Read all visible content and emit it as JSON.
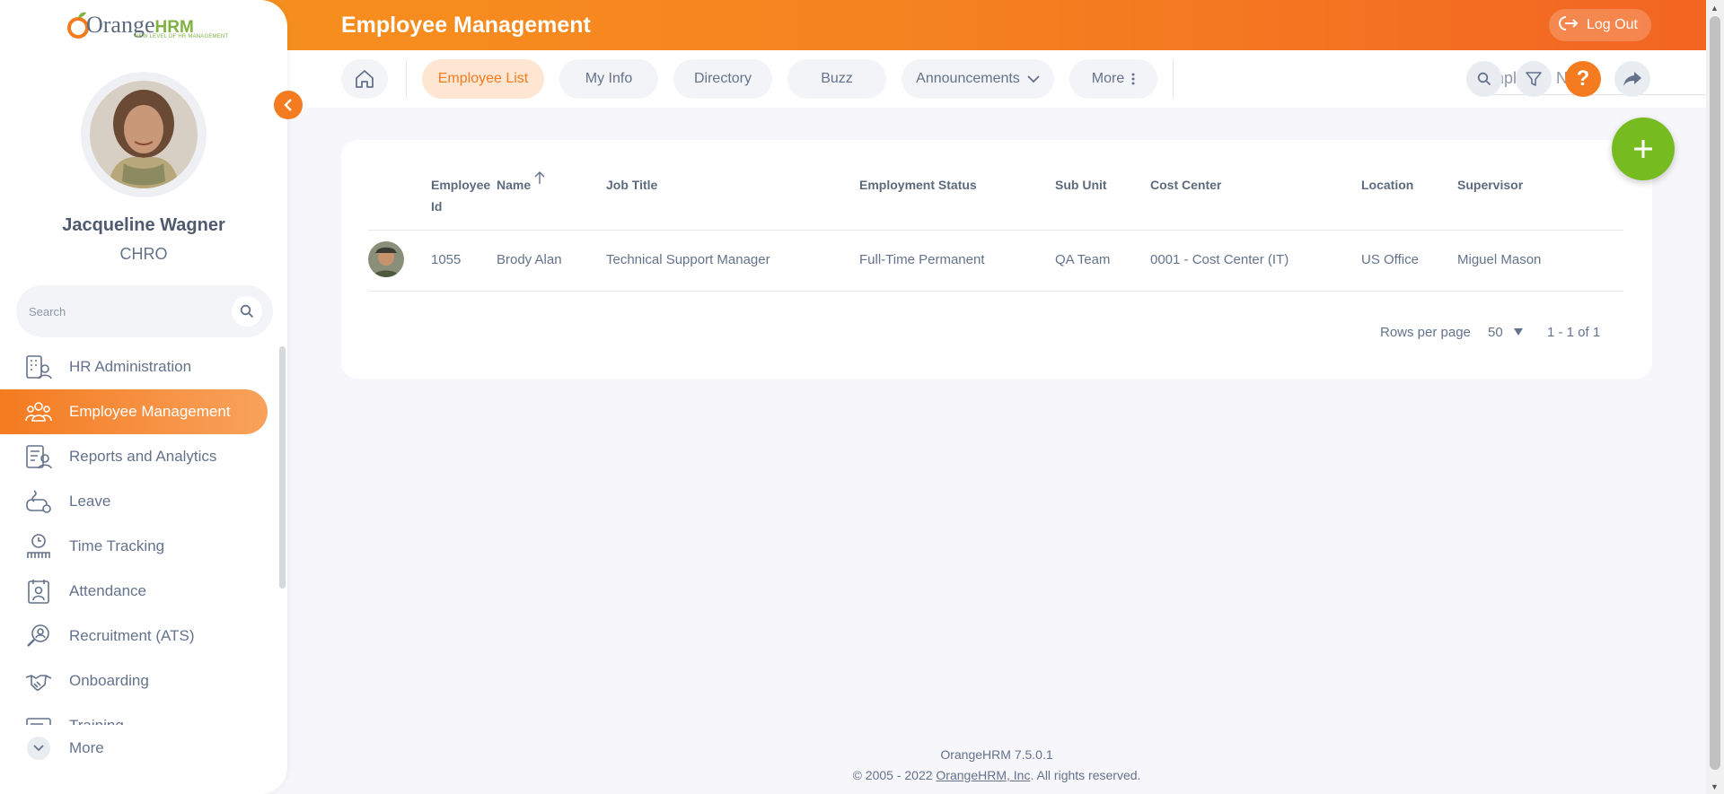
{
  "header": {
    "title": "Employee Management",
    "logout_label": "Log Out"
  },
  "subnav": {
    "tabs": [
      "Employee List",
      "My Info",
      "Directory",
      "Buzz",
      "Announcements",
      "More"
    ],
    "active_tab": "Employee List",
    "search_placeholder": "Employee Name"
  },
  "sidebar": {
    "logo_text": "Orange",
    "logo_hrm": "HRM",
    "logo_tagline": "NEW LEVEL OF HR MANAGEMENT",
    "user_name": "Jacqueline Wagner",
    "user_role": "CHRO",
    "search_placeholder": "Search",
    "items": [
      {
        "label": "HR Administration",
        "icon": "hr-admin-icon"
      },
      {
        "label": "Employee Management",
        "icon": "employee-management-icon",
        "active": true
      },
      {
        "label": "Reports and Analytics",
        "icon": "reports-icon"
      },
      {
        "label": "Leave",
        "icon": "leave-icon"
      },
      {
        "label": "Time Tracking",
        "icon": "time-tracking-icon"
      },
      {
        "label": "Attendance",
        "icon": "attendance-icon"
      },
      {
        "label": "Recruitment (ATS)",
        "icon": "recruitment-icon"
      },
      {
        "label": "Onboarding",
        "icon": "onboarding-icon"
      },
      {
        "label": "Training",
        "icon": "training-icon"
      }
    ],
    "more_label": "More"
  },
  "table": {
    "columns": {
      "employee_id_line1": "Employee",
      "employee_id_line2": "Id",
      "name": "Name",
      "job_title": "Job Title",
      "employment_status": "Employment Status",
      "sub_unit": "Sub Unit",
      "cost_center": "Cost Center",
      "location": "Location",
      "supervisor": "Supervisor"
    },
    "rows": [
      {
        "employee_id": "1055",
        "name": "Brody Alan",
        "job_title": "Technical Support Manager",
        "employment_status": "Full-Time Permanent",
        "sub_unit": "QA Team",
        "cost_center": "0001 - Cost Center (IT)",
        "location": "US Office",
        "supervisor": "Miguel Mason"
      }
    ],
    "rows_per_page_label": "Rows per page",
    "rows_per_page": "50",
    "range": "1 - 1 of 1"
  },
  "footer": {
    "version": "OrangeHRM 7.5.0.1",
    "copyright_prefix": "© 2005 - 2022 ",
    "company_link": "OrangeHRM, Inc",
    "copyright_suffix": ". All rights reserved."
  },
  "colors": {
    "accent": "#f47b20",
    "add_button": "#76bc21",
    "text": "#64728c"
  }
}
